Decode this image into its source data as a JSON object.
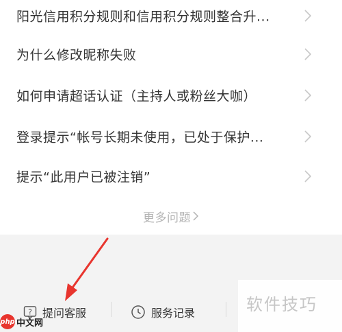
{
  "faq": {
    "items": [
      {
        "text": "阳光信用积分规则和信用积分规则整合升..."
      },
      {
        "text": "为什么修改昵称失败"
      },
      {
        "text": "如何申请超话认证（主持人或粉丝大咖）"
      },
      {
        "text": "登录提示“帐号长期未使用，已处于保护..."
      },
      {
        "text": "提示“此用户已被注销”"
      }
    ],
    "more_label": "更多问题"
  },
  "bottom_bar": {
    "ask_service_label": "提问客服",
    "service_record_label": "服务记录"
  },
  "watermark": {
    "text": "软件技巧"
  },
  "logo": {
    "badge_text": "php",
    "site_text": "中文网"
  },
  "colors": {
    "text": "#333333",
    "muted": "#b3b3b3",
    "chevron": "#c8c8c8",
    "gray_background": "#f3f3f3",
    "arrow": "#e8352e"
  }
}
